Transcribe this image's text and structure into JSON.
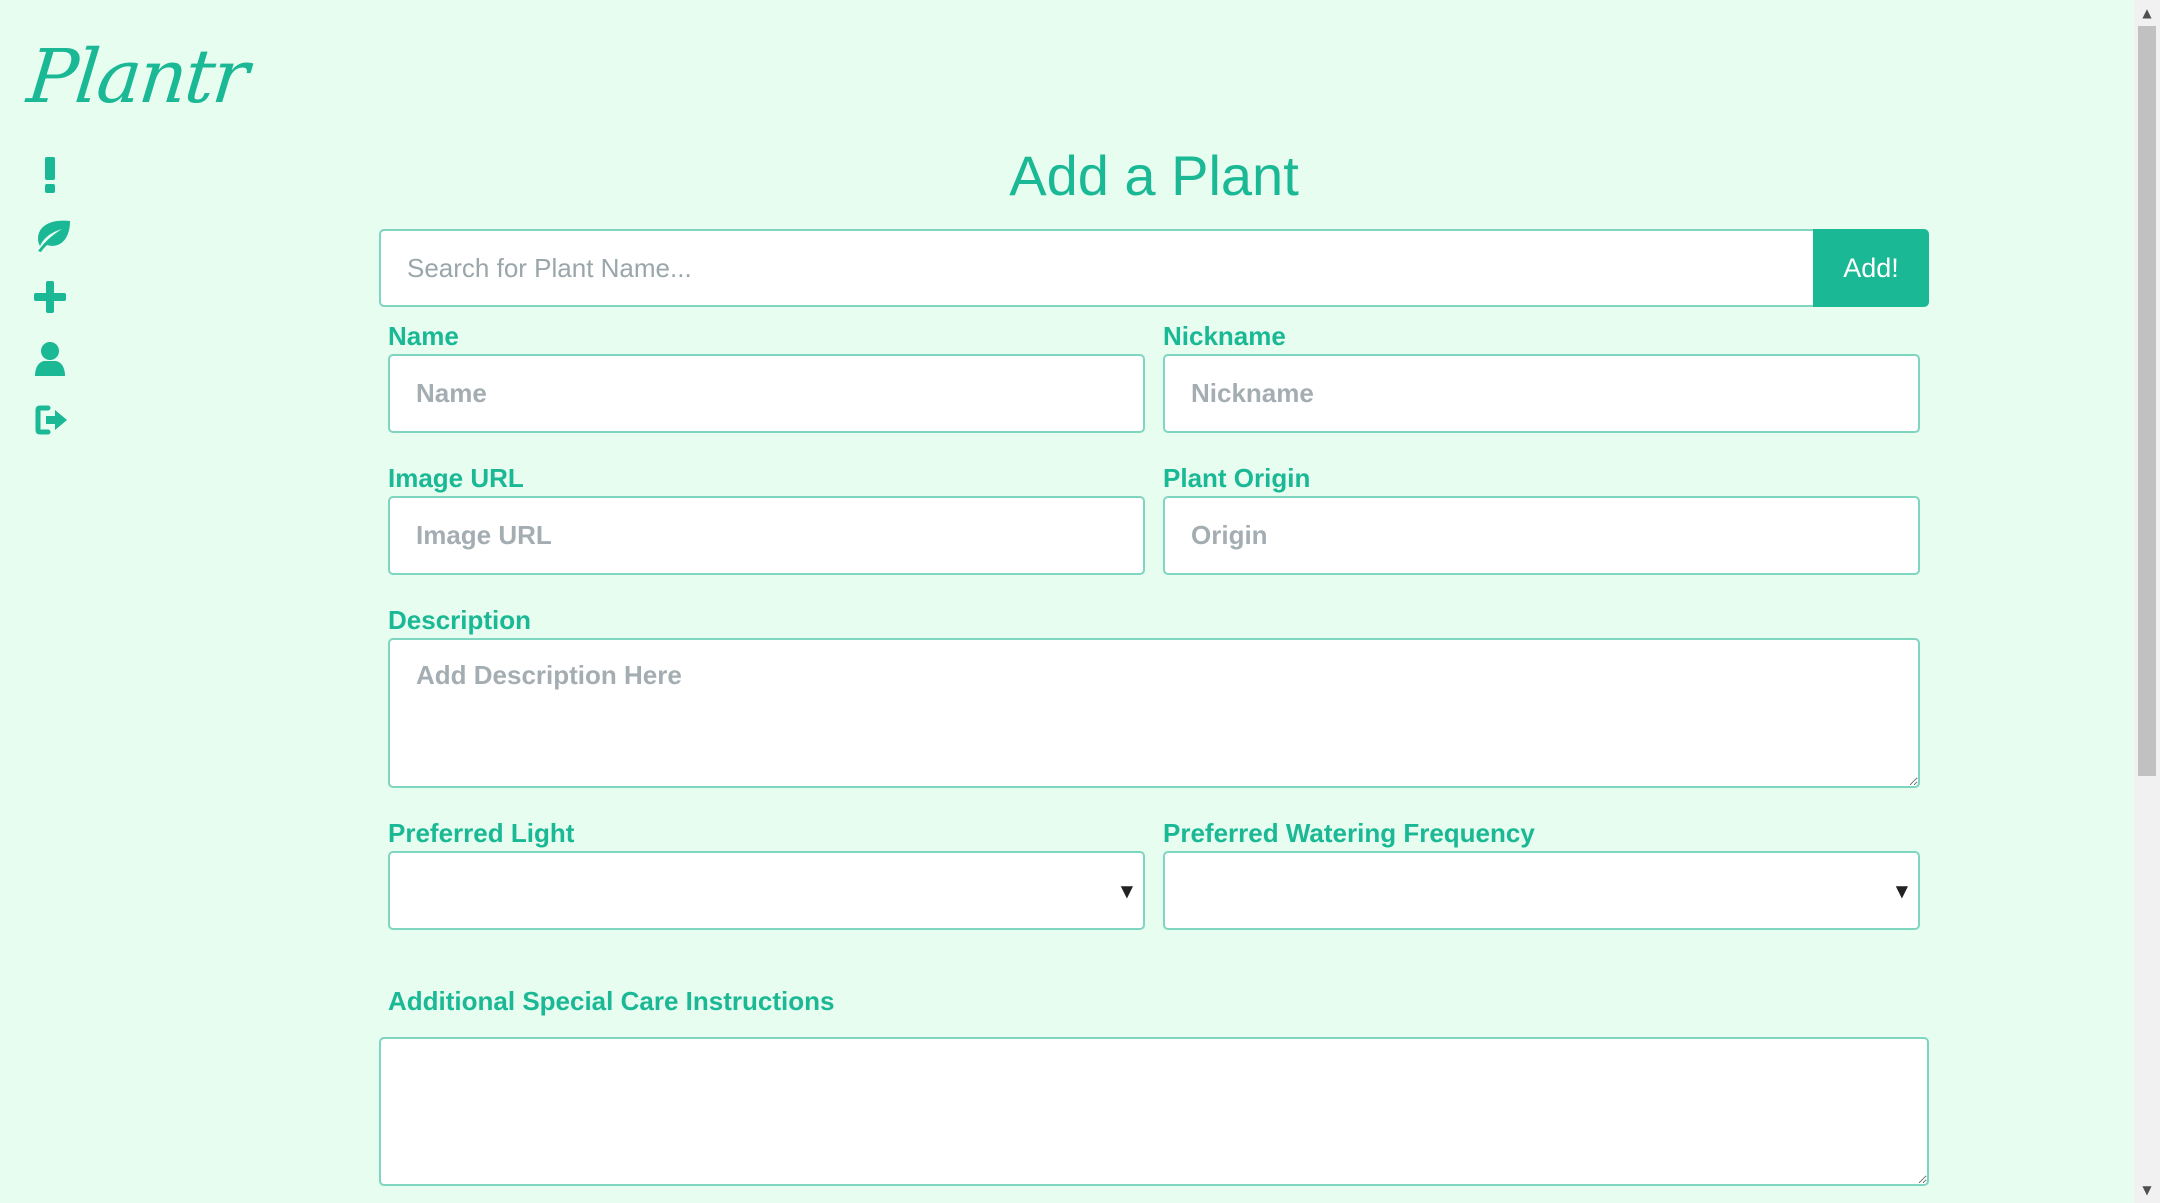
{
  "app": {
    "logo_text": "Plantr"
  },
  "sidebar": {
    "items": [
      {
        "icon": "exclamation-icon",
        "label": "!"
      },
      {
        "icon": "leaf-icon"
      },
      {
        "icon": "plus-icon"
      },
      {
        "icon": "user-icon"
      },
      {
        "icon": "sign-out-icon"
      }
    ]
  },
  "main": {
    "title": "Add a Plant",
    "search": {
      "placeholder": "Search for Plant Name...",
      "value": "",
      "button_label": "Add!"
    },
    "form": {
      "name": {
        "label": "Name",
        "placeholder": "Name",
        "value": ""
      },
      "nickname": {
        "label": "Nickname",
        "placeholder": "Nickname",
        "value": ""
      },
      "image_url": {
        "label": "Image URL",
        "placeholder": "Image URL",
        "value": ""
      },
      "origin": {
        "label": "Plant Origin",
        "placeholder": "Origin",
        "value": ""
      },
      "description": {
        "label": "Description",
        "placeholder": "Add Description Here",
        "value": ""
      },
      "light": {
        "label": "Preferred Light",
        "selected": ""
      },
      "watering": {
        "label": "Preferred Watering Frequency",
        "selected": ""
      },
      "special_care": {
        "label": "Additional Special Care Instructions",
        "value": ""
      }
    }
  },
  "colors": {
    "background": "#e6fdf0",
    "accent": "#1ab894",
    "border": "#7fd6c0"
  }
}
